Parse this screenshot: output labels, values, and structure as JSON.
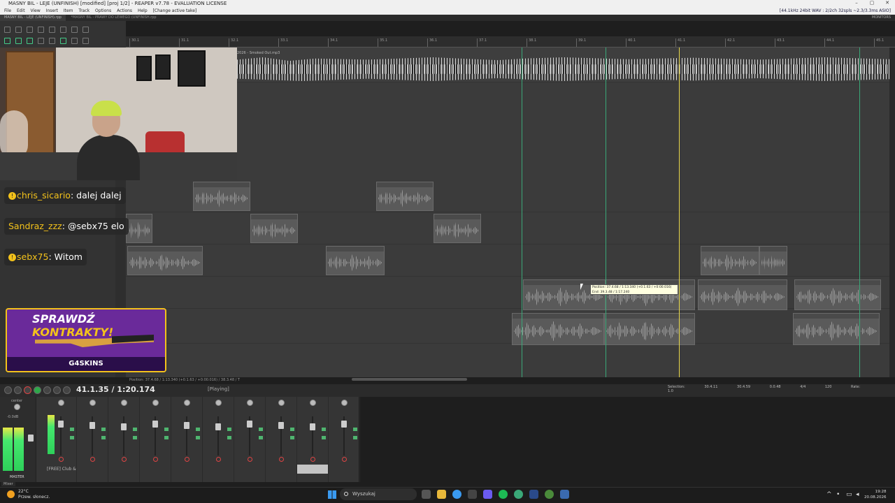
{
  "window": {
    "title": "MASNY BIL - LEJE (UNFINISH) [modified] [proj 1/2] - REAPER v7.78 - EVALUATION LICENSE",
    "audio_info": "[44.1kHz 24bit WAV : 2/2ch 32spls ~2.3/3.3ms ASIO]",
    "monitor_label": "MONITORS"
  },
  "menu": [
    "File",
    "Edit",
    "View",
    "Insert",
    "Item",
    "Track",
    "Options",
    "Actions",
    "Help",
    "[Change active take]"
  ],
  "project_tabs": [
    "MASNY BIL - LEJE (UNFINISH).rpp",
    "*MASNY BIL - PRAWY DO LEWEGO (UNFINISH.rpp"
  ],
  "ruler_ticks": [
    "30.1",
    "31.1",
    "32.1",
    "33.1",
    "34.1",
    "35.1",
    "36.1",
    "37.1",
    "38.1",
    "39.1",
    "40.1",
    "41.1",
    "42.1",
    "43.1",
    "44.1",
    "45.1"
  ],
  "top_item_label": "2026 - Smoked Out.mp3",
  "chat": [
    {
      "name": "chris_sicario",
      "message": "dalej dalej"
    },
    {
      "name": "Sandraz_zzz",
      "message": "@sebx75 elo"
    },
    {
      "name": "sebx75",
      "message": "Witom"
    }
  ],
  "promo": {
    "line1": "SPRAWDŹ",
    "line2": "KONTRAKTY!",
    "brand": "G4SKINS"
  },
  "tooltip": {
    "line1": "Position: 37.4.68 / 1:13.340 (+0.1.63 / +0:00.016)",
    "line2": "End: 39.3.48 / 1:17.240"
  },
  "position_readout": "Position: 37.4.68 / 1:13.340 (+0.1.63 / +0:00.016) / 38.3.48 / T",
  "transport": {
    "timecode": "41.1.35 / 1:20.174",
    "status": "[Playing]"
  },
  "selection": {
    "label": "Selection:",
    "start": "30.4.11",
    "end": "30.4.59",
    "length": "0.0.48",
    "time_sig": "4/4",
    "bpm": "120",
    "rate_label": "Rate:",
    "rate": "1.0"
  },
  "mixer": {
    "master_label": "MASTER",
    "master_db": "-0.0dB",
    "center_label": "center",
    "track_label": "[FREE] Club &",
    "mixer_tab": "Mixer"
  },
  "taskbar": {
    "temperature": "22°C",
    "weather": "Przew. słonecz.",
    "search": "Wyszukaj",
    "time": "19:28",
    "date": "20.08.2026"
  },
  "colors": {
    "accent_green": "#45e86e",
    "playhead": "#e8d84a",
    "chat_name": "#f3c21b",
    "promo_bg": "#6a2a9a"
  }
}
